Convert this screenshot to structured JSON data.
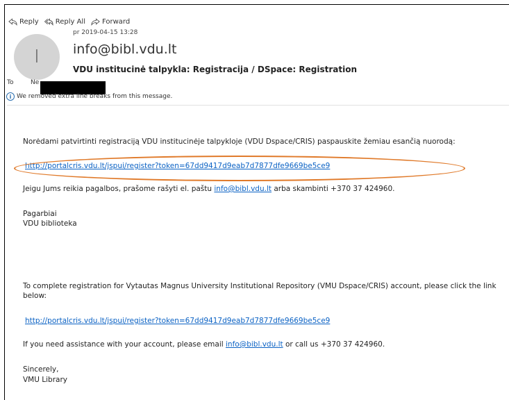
{
  "actions": {
    "reply": "Reply",
    "reply_all": "Reply All",
    "forward": "Forward"
  },
  "header": {
    "date": "pr 2019-04-15 13:28",
    "avatar_initial": "I",
    "sender": "info@bibl.vdu.lt",
    "subject": "VDU institucinė talpykla: Registracija / DSpace: Registration",
    "to_label": "To",
    "to_name": "Ne",
    "notice": "We removed extra line breaks from this message."
  },
  "body": {
    "lt_intro": "Norėdami patvirtinti registraciją VDU institucinėje talpykloje (VDU Dspace/CRIS) paspauskite žemiau esančią nuorodą:",
    "lt_link": "http://portalcris.vdu.lt/jspui/register?token=67dd9417d9eab7d7877dfe9669be5ce9",
    "lt_help_pre": "Jeigu Jums reikia pagalbos, prašome rašyti el. paštu ",
    "lt_help_email": "info@bibl.vdu.lt",
    "lt_help_post": " arba skambinti +370 37 424960.",
    "lt_regards": "Pagarbiai",
    "lt_sign": "VDU biblioteka",
    "en_intro_1": "To complete registration for Vytautas Magnus University Institutional Repository (VMU Dspace/CRIS) account, please click the link",
    "en_intro_2": "below:",
    "en_link": "http://portalcris.vdu.lt/jspui/register?token=67dd9417d9eab7d7877dfe9669be5ce9",
    "en_help_pre": "If you need assistance with your account, please email ",
    "en_help_email": "info@bibl.vdu.lt",
    "en_help_post": " or call us +370 37 424960.",
    "en_regards": "Sincerely,",
    "en_sign": "VMU Library"
  },
  "colors": {
    "link": "#0b62c4",
    "highlight_oval": "#e07a2a"
  }
}
